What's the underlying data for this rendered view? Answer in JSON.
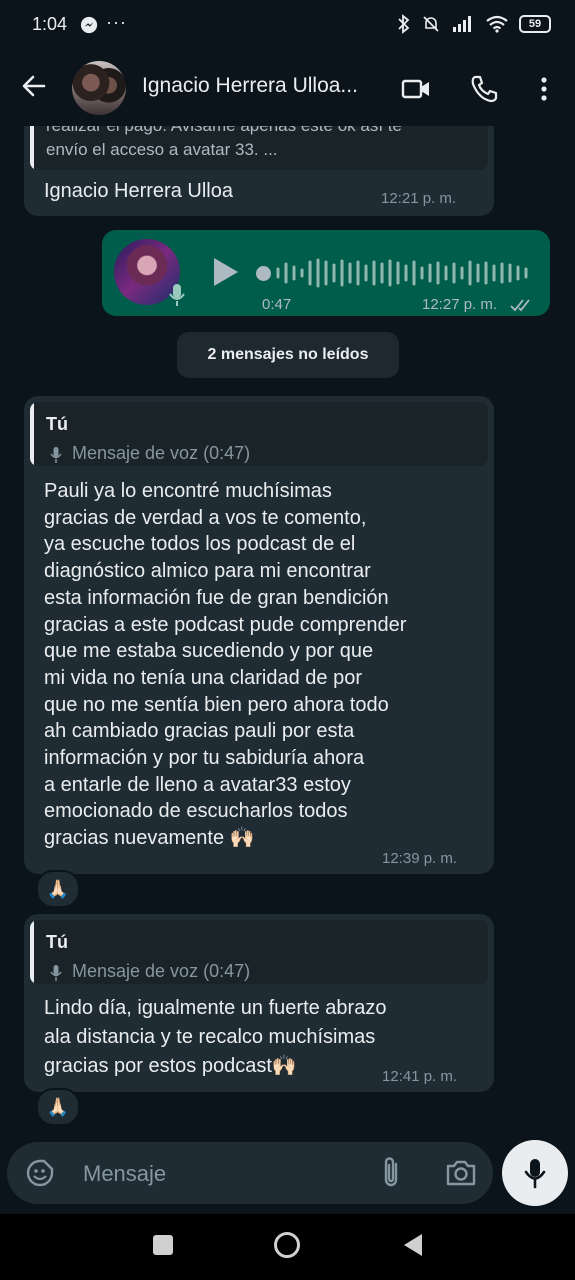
{
  "status_bar": {
    "time": "1:04",
    "battery": "59"
  },
  "header": {
    "contact_name": "Ignacio Herrera Ulloa..."
  },
  "messages": {
    "top_partial": {
      "quoted_text": "realizar el pago. Avisame apenas este ok así te\nenvío el acceso a avatar 33. ...",
      "author": "Ignacio Herrera Ulloa",
      "time": "12:21 p. m."
    },
    "voice_out": {
      "duration": "0:47",
      "time": "12:27 p. m."
    },
    "unread_divider": "2 mensajes no leídos",
    "msg1": {
      "quote_author": "Tú",
      "quote_sub": "Mensaje de voz (0:47)",
      "text": "Pauli ya lo encontré muchísimas\ngracias de verdad a vos te comento,\nya escuche todos los podcast de el\ndiagnóstico almico para mi encontrar\nesta información fue de gran bendición\ngracias a este podcast pude comprender\nque me estaba sucediendo y por que\nmi vida no tenía una claridad de por\nque no me sentía bien pero ahora todo\nah cambiado gracias pauli por esta\ninformación y por tu sabiduría ahora\na entarle de lleno a avatar33 estoy\nemocionado de escucharlos todos\ngracias nuevamente 🙌🏻",
      "time": "12:39 p. m.",
      "reaction": "🙏🏻"
    },
    "msg2": {
      "quote_author": "Tú",
      "quote_sub": "Mensaje de voz (0:47)",
      "text": "Lindo día, igualmente un fuerte abrazo\nala distancia  y te recalco muchísimas\ngracias por estos podcast🙌🏻",
      "time": "12:41 p. m.",
      "reaction": "🙏🏻"
    }
  },
  "composer": {
    "placeholder": "Mensaje"
  },
  "colors": {
    "background": "#0b141a",
    "incoming_bubble": "#202c33",
    "outgoing_bubble": "#005c4b",
    "secondary_text": "#8696a0"
  },
  "icons": [
    "back-arrow-icon",
    "video-call-icon",
    "phone-icon",
    "more-vert-icon",
    "emoji-icon",
    "attach-icon",
    "camera-icon",
    "mic-icon",
    "play-icon",
    "double-check-icon"
  ]
}
